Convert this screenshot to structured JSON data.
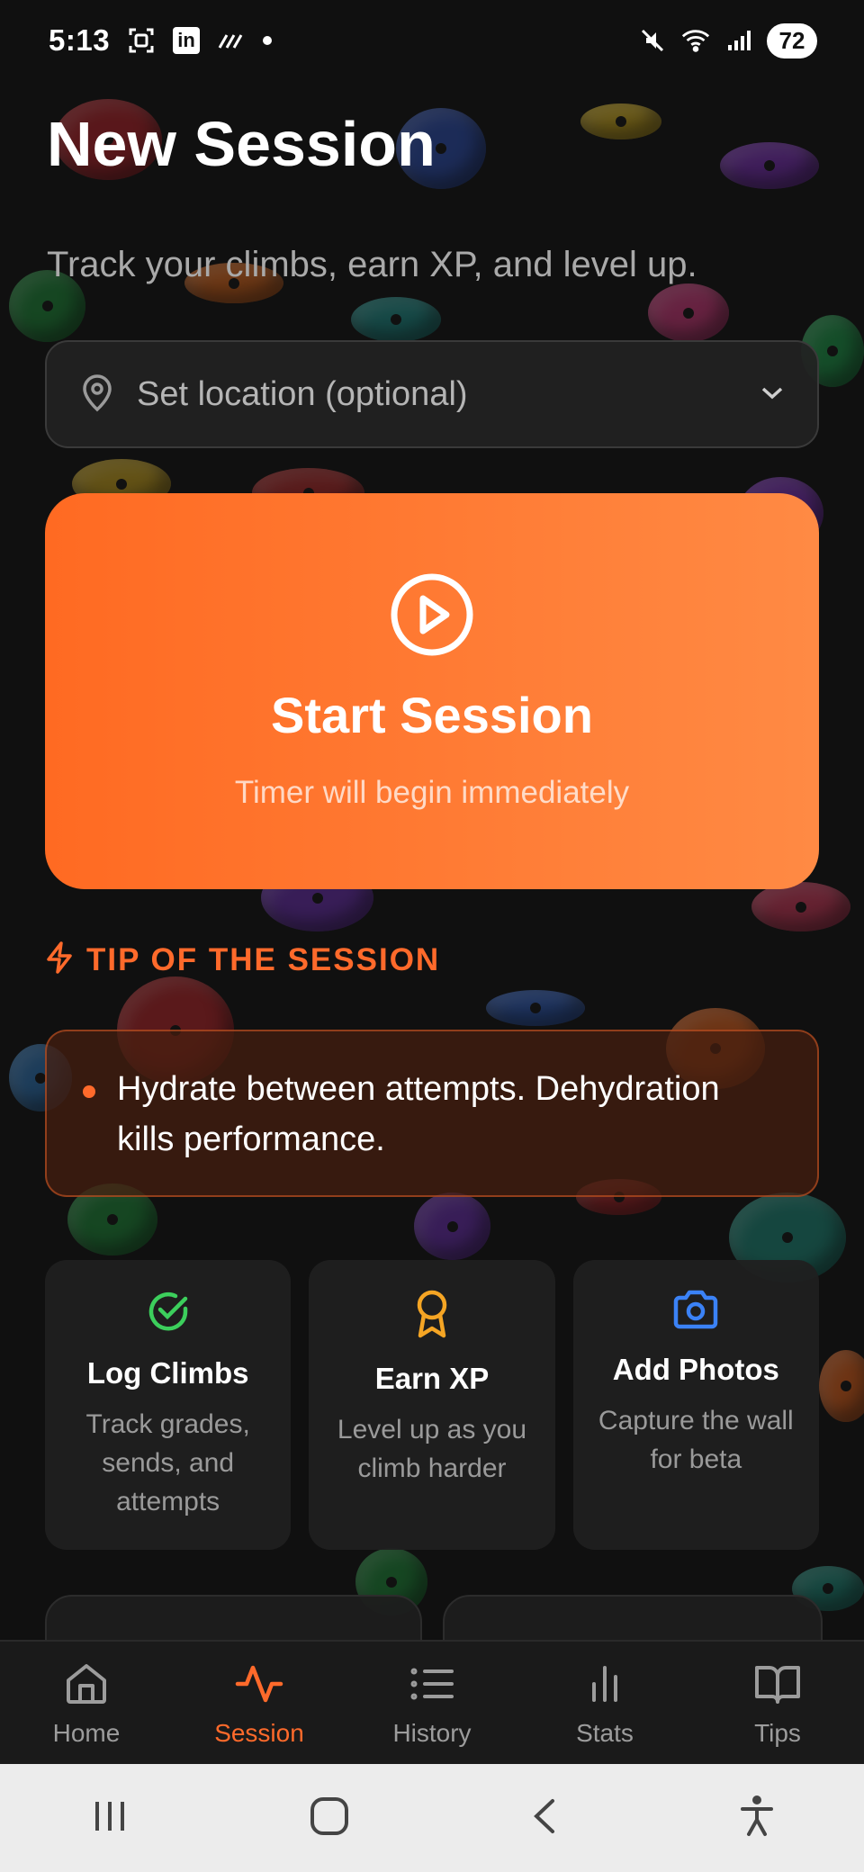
{
  "status_bar": {
    "time": "5:13",
    "battery": "72"
  },
  "header": {
    "title": "New Session",
    "subtitle": "Track your climbs, earn XP, and level up."
  },
  "location": {
    "label": "Set location (optional)"
  },
  "start_session": {
    "title": "Start Session",
    "subtitle": "Timer will begin immediately"
  },
  "tip": {
    "heading": "TIP OF THE SESSION",
    "text": "Hydrate between attempts. Dehydration kills performance."
  },
  "features": [
    {
      "title": "Log Climbs",
      "desc": "Track grades, sends, and attempts",
      "icon": "check-circle-icon",
      "color": "#3ccf5c"
    },
    {
      "title": "Earn XP",
      "desc": "Level up as you climb harder",
      "icon": "award-icon",
      "color": "#f5a524"
    },
    {
      "title": "Add Photos",
      "desc": "Capture the wall for beta",
      "icon": "camera-icon",
      "color": "#3b82f6"
    }
  ],
  "nav": [
    {
      "label": "Home",
      "icon": "home-icon"
    },
    {
      "label": "Session",
      "icon": "activity-icon",
      "active": true
    },
    {
      "label": "History",
      "icon": "list-icon"
    },
    {
      "label": "Stats",
      "icon": "bar-chart-icon"
    },
    {
      "label": "Tips",
      "icon": "book-icon"
    }
  ],
  "colors": {
    "accent": "#ff6a2b",
    "background": "#121212",
    "card": "#202020"
  }
}
